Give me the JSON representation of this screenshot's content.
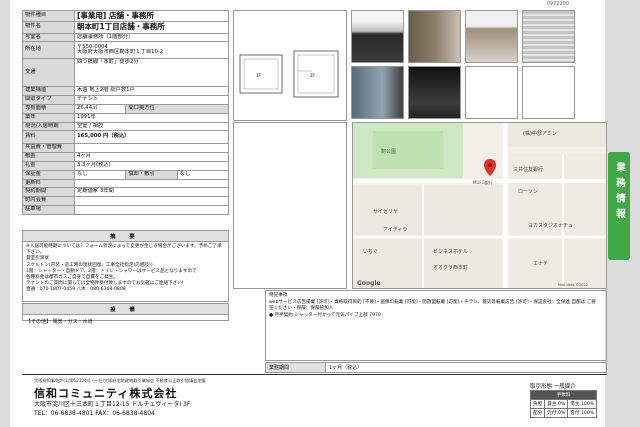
{
  "doc_id": "0972200",
  "spec": {
    "type_label": "物件種目",
    "type_value": "[事業用] 店舗・事務所",
    "name_label": "物件名",
    "name_value": "朝本町1丁目店舗・事務所",
    "room_label": "号室名",
    "room_value": "店舗事務所（1階部分）",
    "addr_label": "所在地",
    "addr_zip": "〒550-0004",
    "addr_value": "大阪府大阪市西区靭本町１丁目10-2",
    "traffic_label": "交通",
    "traffic_value": "四つ橋線「本町」徒歩2分",
    "structure_label": "建築構造",
    "structure_value": "木造 地上2階 総戸数1戸",
    "layout_label": "間取タイプ",
    "layout_value": "テナント",
    "area_label": "専有面積",
    "area_value": "26.44㎡",
    "area_sub_label": "間口奥方位",
    "built_label": "築年",
    "built_value": "1991年",
    "status_label": "現況/入居時期",
    "status_value": "空室 / 相談",
    "rent_label": "賃料",
    "rent_value": "165,000 円（税込）",
    "common_label": "共益費・管理費",
    "deposit_label": "敷金",
    "deposit_value": "4ヶ月",
    "key_label": "礼金",
    "key_value": "3.3ヶ月(税込)",
    "guar_label": "保証金",
    "guar_value": "なし",
    "amort_label": "償却・敷引",
    "amort_value": "なし",
    "renew_label": "更新料",
    "contract_label": "契約期間",
    "contract_value": "定期借家 3年間",
    "town_label": "町内会費",
    "parking_label": "駐車場"
  },
  "notes": {
    "title": "摘 要",
    "lines": [
      "※入居可能時期については？フォーム状況によって変更が生じる場合がございます。予めご了承下さい。",
      "貸室引渡状",
      "スケルトン(内装・造工時の現状回復、工事全社指定(応相談))",
      "1階：シャッター・自動ドア、2階：トイレ・シャワーはサービス品となりますので",
      "各種料金は都市ガスご自身で自費をご発生。",
      "テナントのご質問に関しては全物件受付致しますのでお気軽にご連絡下さい!",
      "直通 : 070-1807-0459  八木 : 080-6368-0808"
    ]
  },
  "equip": {
    "title": "設 備",
    "value": "【その他】 電気・ガス・水道"
  },
  "features": {
    "label": "特記事項",
    "lines": [
      "webサービス広告掲載 [許可]・資格取得目的 [不要]・画像の転載 [可能]・開放図転載 [可能]・チラシ、雑誌等転載広告 [許可]・保証会社：全保連 自都は ご要",
      "望ください・保険：保険管加入",
      "● 月半契約:シャッター付かって元気パイプ上部 7970"
    ]
  },
  "move": {
    "label": "業務期間",
    "value": "1ヶ月（税込）"
  },
  "map": {
    "labels": [
      "(株)中部アミン",
      "MUFG銀行",
      "靭公園",
      "三井住友銀行",
      "ローソン",
      "サイゼリヤ",
      "ヨカスタジオナチュ",
      "ビジネスホテル",
      "オオクラ西本町",
      "エナテ",
      "いちぐ",
      "アイディラ"
    ],
    "footer": "Google",
    "copyright": "Map data ©2022"
  },
  "side_tab": "業務情報",
  "footer": {
    "license": "大阪府知事免許(1)第62304号 (一社)大阪府宅地建物取引業協会 不動産公正取引協議会加盟",
    "company": "信和コミュニティ株式会社",
    "address": "大阪市淀川区十三本町１丁目12-15 ドルチェヴィータⅠ 3F",
    "tel": "TEL：06-6838-4801  FAX：06-6838-4804",
    "fee_title": "取引形態 一般媒介",
    "fee_head": "手数料",
    "fee_rows": [
      [
        "負担",
        "貸主:0%",
        "借主:100%"
      ],
      [
        "配分",
        "元付:0%",
        "客付:100%"
      ]
    ]
  },
  "plan": {
    "room1": "1F",
    "room2": "2F"
  }
}
